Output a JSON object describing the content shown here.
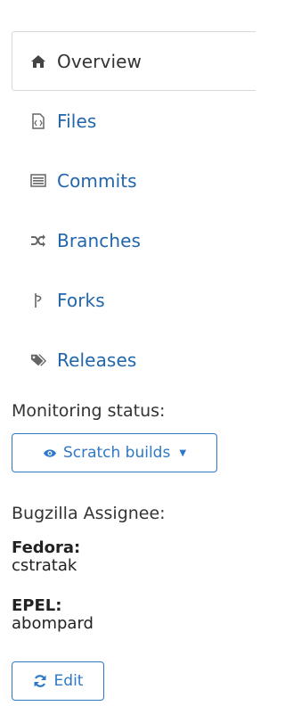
{
  "nav": {
    "items": [
      {
        "label": "Overview",
        "icon": "home-icon",
        "active": true
      },
      {
        "label": "Files",
        "icon": "file-code-icon",
        "active": false
      },
      {
        "label": "Commits",
        "icon": "list-icon",
        "active": false
      },
      {
        "label": "Branches",
        "icon": "random-icon",
        "active": false
      },
      {
        "label": "Forks",
        "icon": "fork-icon",
        "active": false
      },
      {
        "label": "Releases",
        "icon": "tags-icon",
        "active": false
      }
    ]
  },
  "monitoring": {
    "label": "Monitoring status:",
    "button_label": "Scratch builds",
    "button_icon": "eye-icon"
  },
  "bugzilla": {
    "label": "Bugzilla Assignee:",
    "assignees": [
      {
        "branch": "Fedora:",
        "user": "cstratak"
      },
      {
        "branch": "EPEL:",
        "user": "abompard"
      }
    ]
  },
  "edit": {
    "label": "Edit",
    "icon": "refresh-icon"
  },
  "colors": {
    "link": "#2266aa",
    "button_accent": "#2e78c7",
    "text": "#333333",
    "border": "#d8d8d8"
  }
}
